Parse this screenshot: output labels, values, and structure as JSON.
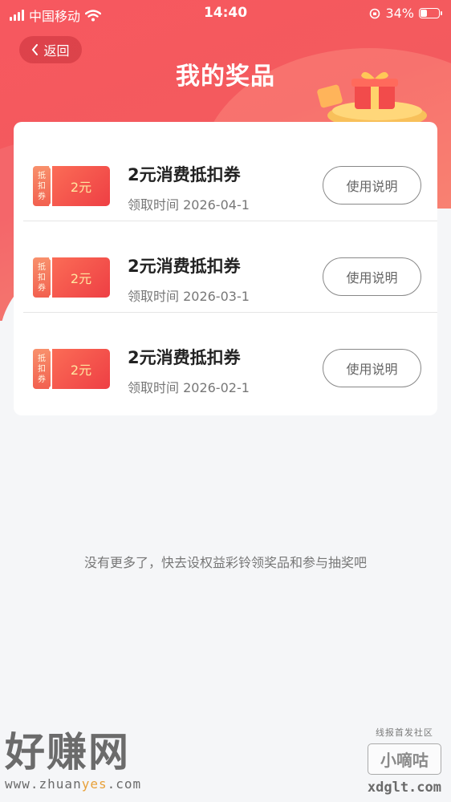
{
  "status_bar": {
    "carrier": "中国移动",
    "time": "14:40",
    "battery": "34%"
  },
  "header": {
    "back_label": "返回",
    "title": "我的奖品"
  },
  "prizes": [
    {
      "stub_text": [
        "抵",
        "扣",
        "券"
      ],
      "value_label": "2元",
      "title": "2元消费抵扣券",
      "date": "领取时间  2026-04-1",
      "button": "使用说明"
    },
    {
      "stub_text": [
        "抵",
        "扣",
        "券"
      ],
      "value_label": "2元",
      "title": "2元消费抵扣券",
      "date": "领取时间  2026-03-1",
      "button": "使用说明"
    },
    {
      "stub_text": [
        "抵",
        "扣",
        "券"
      ],
      "value_label": "2元",
      "title": "2元消费抵扣券",
      "date": "领取时间  2026-02-1",
      "button": "使用说明"
    }
  ],
  "footer_note": "没有更多了，快去设权益彩铃领奖品和参与抽奖吧",
  "watermarks": {
    "left_title": "好赚网",
    "left_url_a": "www.zhuan",
    "left_url_b": "yes",
    "left_url_c": ".com",
    "right_tag": "线报首发社区",
    "right_name": "小嘀咕",
    "right_url": "xdglt.com"
  },
  "colors": {
    "header_red": "#f7585f",
    "coupon_red": "#ee3f44",
    "coupon_gold_text": "#ffe7a0"
  }
}
